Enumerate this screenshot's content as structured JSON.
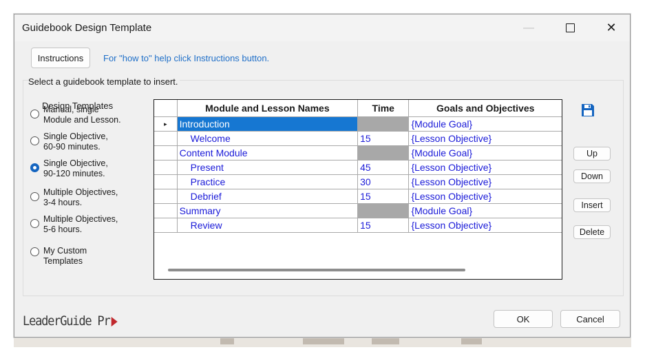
{
  "window": {
    "title": "Guidebook Design Template"
  },
  "toolbar": {
    "instructions_label": "Instructions",
    "help_text": "For \"how to\" help click Instructions button."
  },
  "select_label": "Select a guidebook template to insert.",
  "design_templates": {
    "label": "Design Templates",
    "selected_index": 2,
    "options": [
      {
        "line1": "Manual, single",
        "line2": "Module and Lesson."
      },
      {
        "line1": "Single Objective,",
        "line2": "60-90 minutes."
      },
      {
        "line1": "Single Objective,",
        "line2": "90-120 minutes."
      },
      {
        "line1": "Multiple Objectives,",
        "line2": "3-4 hours."
      },
      {
        "line1": "Multiple Objectives,",
        "line2": "5-6 hours."
      },
      {
        "line1": "My Custom Templates",
        "line2": ""
      }
    ]
  },
  "grid": {
    "columns": [
      "Module and Lesson Names",
      "Time",
      "Goals and Objectives"
    ],
    "rows": [
      {
        "name": "Introduction",
        "time": "",
        "goal": "{Module Goal}",
        "type": "module",
        "current": true
      },
      {
        "name": "Welcome",
        "time": "15",
        "goal": "{Lesson Objective}",
        "type": "lesson"
      },
      {
        "name": "Content Module",
        "time": "",
        "goal": "{Module Goal}",
        "type": "module"
      },
      {
        "name": "Present",
        "time": "45",
        "goal": "{Lesson Objective}",
        "type": "lesson"
      },
      {
        "name": "Practice",
        "time": "30",
        "goal": "{Lesson Objective}",
        "type": "lesson"
      },
      {
        "name": "Debrief",
        "time": "15",
        "goal": "{Lesson Objective}",
        "type": "lesson"
      },
      {
        "name": "Summary",
        "time": "",
        "goal": "{Module Goal}",
        "type": "module"
      },
      {
        "name": "Review",
        "time": "15",
        "goal": "{Lesson Objective}",
        "type": "lesson"
      }
    ],
    "row_indicator": "▸"
  },
  "side_buttons": {
    "up": "Up",
    "down": "Down",
    "insert": "Insert",
    "delete": "Delete"
  },
  "icons": {
    "save": "save-icon",
    "save_color": "#1565c0"
  },
  "logo": {
    "text": "LeaderGuide Pr",
    "mark_color": "#c0282d"
  },
  "footer": {
    "ok": "OK",
    "cancel": "Cancel"
  },
  "colors": {
    "accent": "#1677d2",
    "link": "#1f6fc8",
    "cell_text": "#1a1ad8",
    "module_time_fill": "#a8a8a8"
  }
}
